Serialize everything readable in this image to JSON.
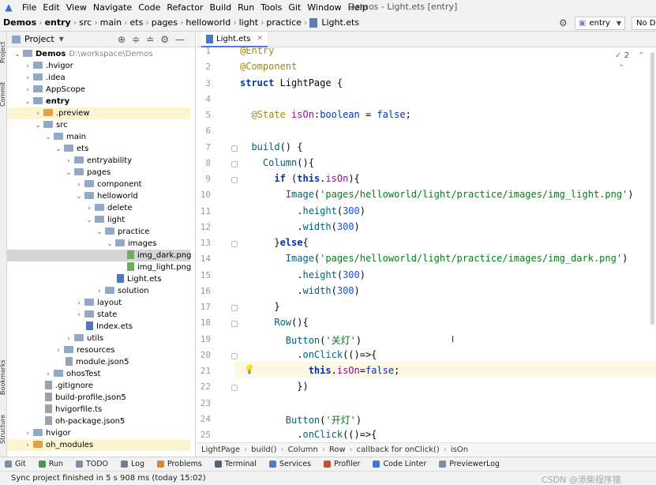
{
  "menubar": {
    "items": [
      "File",
      "Edit",
      "View",
      "Navigate",
      "Code",
      "Refactor",
      "Build",
      "Run",
      "Tools",
      "Git",
      "Window",
      "Help"
    ],
    "window_title": "Demos - Light.ets [entry]"
  },
  "navbar": {
    "crumbs": [
      "Demos",
      "entry",
      "src",
      "main",
      "ets",
      "pages",
      "helloworld",
      "light",
      "practice",
      "Light.ets"
    ],
    "run_config": "entry",
    "device": "No De"
  },
  "side_strip": {
    "top": [
      "Project",
      "Commit"
    ],
    "bottom": [
      "Bookmarks",
      "Structure"
    ]
  },
  "project_panel": {
    "title": "Project",
    "tree": [
      {
        "label": "Demos",
        "path": "D:\\workspace\\Demos",
        "depth": 0,
        "open": true,
        "type": "folder",
        "bold": true
      },
      {
        "label": ".hvigor",
        "depth": 1,
        "open": false,
        "type": "folder"
      },
      {
        "label": ".idea",
        "depth": 1,
        "open": false,
        "type": "folder"
      },
      {
        "label": "AppScope",
        "depth": 1,
        "open": false,
        "type": "folder"
      },
      {
        "label": "entry",
        "depth": 1,
        "open": true,
        "type": "folder",
        "bold": true
      },
      {
        "label": ".preview",
        "depth": 2,
        "open": false,
        "type": "folder-orange",
        "hl": true
      },
      {
        "label": "src",
        "depth": 2,
        "open": true,
        "type": "folder"
      },
      {
        "label": "main",
        "depth": 3,
        "open": true,
        "type": "folder"
      },
      {
        "label": "ets",
        "depth": 4,
        "open": true,
        "type": "folder"
      },
      {
        "label": "entryability",
        "depth": 5,
        "open": false,
        "type": "folder"
      },
      {
        "label": "pages",
        "depth": 5,
        "open": true,
        "type": "folder"
      },
      {
        "label": "component",
        "depth": 6,
        "open": false,
        "type": "folder"
      },
      {
        "label": "helloworld",
        "depth": 6,
        "open": true,
        "type": "folder"
      },
      {
        "label": "delete",
        "depth": 7,
        "open": false,
        "type": "folder"
      },
      {
        "label": "light",
        "depth": 7,
        "open": true,
        "type": "folder"
      },
      {
        "label": "practice",
        "depth": 8,
        "open": true,
        "type": "folder"
      },
      {
        "label": "images",
        "depth": 9,
        "open": true,
        "type": "folder"
      },
      {
        "label": "img_dark.png",
        "depth": 10,
        "type": "img",
        "sel": true
      },
      {
        "label": "img_light.png",
        "depth": 10,
        "type": "img"
      },
      {
        "label": "Light.ets",
        "depth": 9,
        "type": "ets"
      },
      {
        "label": "solution",
        "depth": 8,
        "open": false,
        "type": "folder"
      },
      {
        "label": "layout",
        "depth": 6,
        "open": false,
        "type": "folder"
      },
      {
        "label": "state",
        "depth": 6,
        "open": false,
        "type": "folder"
      },
      {
        "label": "Index.ets",
        "depth": 6,
        "type": "ets"
      },
      {
        "label": "utils",
        "depth": 5,
        "open": false,
        "type": "folder"
      },
      {
        "label": "resources",
        "depth": 4,
        "open": false,
        "type": "folder"
      },
      {
        "label": "module.json5",
        "depth": 4,
        "type": "file"
      },
      {
        "label": "ohosTest",
        "depth": 3,
        "open": false,
        "type": "folder"
      },
      {
        "label": ".gitignore",
        "depth": 2,
        "type": "file"
      },
      {
        "label": "build-profile.json5",
        "depth": 2,
        "type": "file"
      },
      {
        "label": "hvigorfile.ts",
        "depth": 2,
        "type": "file"
      },
      {
        "label": "oh-package.json5",
        "depth": 2,
        "type": "file"
      },
      {
        "label": "hvigor",
        "depth": 1,
        "open": false,
        "type": "folder"
      },
      {
        "label": "oh_modules",
        "depth": 1,
        "open": false,
        "type": "folder-orange",
        "hl": true
      }
    ]
  },
  "editor": {
    "tab_label": "Light.ets",
    "inspection_count": "2",
    "lines": [
      {
        "n": "1",
        "html": "<span class=\"dec\">@Entry</span>"
      },
      {
        "n": "2",
        "html": "<span class=\"dec\">@Component</span>"
      },
      {
        "n": "3",
        "html": "<span class=\"kwb\">struct</span> LightPage {"
      },
      {
        "n": "4",
        "html": ""
      },
      {
        "n": "5",
        "html": "  <span class=\"dec\">@State</span> <span class=\"prop\">isOn</span>:<span class=\"kw\">boolean</span> = <span class=\"kw\">false</span>;"
      },
      {
        "n": "6",
        "html": ""
      },
      {
        "n": "7",
        "html": "  <span class=\"fn\">build</span>() {"
      },
      {
        "n": "8",
        "html": "    <span class=\"fn\">Column</span>(){"
      },
      {
        "n": "9",
        "html": "      <span class=\"kwb\">if</span> (<span class=\"kwb\">this</span>.<span class=\"prop\">isOn</span>){"
      },
      {
        "n": "10",
        "html": "        <span class=\"fn\">Image</span>(<span class=\"str\">'pages/helloworld/light/practice/images/img_light.png'</span>)"
      },
      {
        "n": "11",
        "html": "          .<span class=\"fnc\">height</span>(<span class=\"num\">300</span>)"
      },
      {
        "n": "12",
        "html": "          .<span class=\"fnc\">width</span>(<span class=\"num\">300</span>)"
      },
      {
        "n": "13",
        "html": "      }<span class=\"kwb\">else</span>{"
      },
      {
        "n": "14",
        "html": "        <span class=\"fn\">Image</span>(<span class=\"str\">'pages/helloworld/light/practice/images/img_dark.png'</span>)"
      },
      {
        "n": "15",
        "html": "          .<span class=\"fnc\">height</span>(<span class=\"num\">300</span>)"
      },
      {
        "n": "16",
        "html": "          .<span class=\"fnc\">width</span>(<span class=\"num\">300</span>)"
      },
      {
        "n": "17",
        "html": "      }"
      },
      {
        "n": "18",
        "html": "      <span class=\"fn\">Row</span>(){"
      },
      {
        "n": "19",
        "html": "        <span class=\"fn\">Button</span>(<span class=\"str\">'关灯'</span>)"
      },
      {
        "n": "20",
        "html": "          .<span class=\"fnc\">onClick</span>(()=>{"
      },
      {
        "n": "21",
        "html": "            <span class=\"kwb\">this</span>.<span class=\"prop\">isOn</span>=<span class=\"kw\">false</span>;"
      },
      {
        "n": "22",
        "html": "          })"
      },
      {
        "n": "23",
        "html": ""
      },
      {
        "n": "24",
        "html": "        <span class=\"fn\">Button</span>(<span class=\"str\">'开灯'</span>)"
      },
      {
        "n": "25",
        "html": "          .<span class=\"fnc\">onClick</span>(()=>{"
      }
    ],
    "breadcrumb": [
      "LightPage",
      "build()",
      "Column",
      "Row",
      "callback for onClick()",
      "isOn"
    ]
  },
  "toolwindows": [
    "Git",
    "Run",
    "TODO",
    "Log",
    "Problems",
    "Terminal",
    "Services",
    "Profiler",
    "Code Linter",
    "PreviewerLog"
  ],
  "status": {
    "message": "Sync project finished in 5 s 908 ms (today 15:02)",
    "watermark": "CSDN @添柴程序猿"
  },
  "colors": {
    "accent": "#4a7cd1",
    "selection": "#d5d5d5",
    "highlight": "#fbf5d3"
  }
}
